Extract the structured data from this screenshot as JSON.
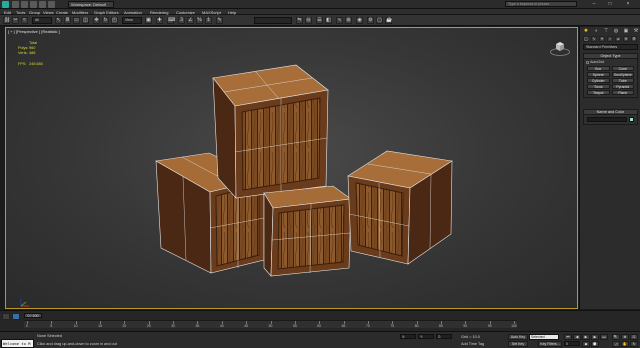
{
  "title_bar": {
    "workspace": "Workspace: Default",
    "search_placeholder": "Type a keyword or phrase",
    "minimize": "–",
    "maximize": "□",
    "close": "×"
  },
  "menu": [
    "Edit",
    "Tools",
    "Group",
    "Views",
    "Create",
    "Modifiers",
    "Graph Editors",
    "Animation",
    "Rendering",
    "Customize",
    "MAXScript",
    "Help"
  ],
  "toolbar": {
    "filter": "All",
    "ref_coord": "View",
    "selection_set": ""
  },
  "viewport": {
    "label": "[ + ] [Perspective ] [Realistic ]",
    "stats": [
      {
        "key": "",
        "value": "Total"
      },
      {
        "key": "Polys:",
        "value": "960"
      },
      {
        "key": "Verts:",
        "value": "488"
      }
    ],
    "fps_label": "FPS:",
    "fps_value": "245.685",
    "wire_color": "#e8e8e8",
    "wood_light": "#8b5a2b",
    "wood_dark": "#4a2812"
  },
  "command_panel": {
    "tabs": [
      "create-tab",
      "modify-tab",
      "hierarchy-tab",
      "motion-tab",
      "display-tab",
      "utilities-tab"
    ],
    "category_icons": [
      "geometry-icon",
      "shapes-icon",
      "lights-icon",
      "cameras-icon",
      "helpers-icon",
      "spacewarps-icon",
      "systems-icon"
    ],
    "dropdown": "Standard Primitives",
    "object_type_header": "Object Type",
    "autogrid": "AutoGrid",
    "buttons": [
      "Box",
      "Cone",
      "Sphere",
      "GeoSphere",
      "Cylinder",
      "Tube",
      "Torus",
      "Pyramid",
      "Teapot",
      "Plane"
    ],
    "name_color_header": "Name and Color",
    "name_value": "",
    "swatch_color": "#9fdcd0"
  },
  "timeline": {
    "slider_label": "0 / 100",
    "ticks": [
      "0",
      "5",
      "10",
      "15",
      "20",
      "25",
      "30",
      "35",
      "40",
      "45",
      "50",
      "55",
      "60",
      "65",
      "70",
      "75",
      "80",
      "85",
      "90",
      "95",
      "100"
    ]
  },
  "status": {
    "maxscript": "Welcome to M",
    "selection_info": "None Selected",
    "prompt": "Click and drag up-and-down to zoom in and out",
    "x": "X:",
    "y": "Y:",
    "z": "Z:",
    "grid": "Grid = 10.0",
    "add_time_tag": "Add Time Tag",
    "auto_key": "Auto Key",
    "selected": "Selected",
    "set_key": "Set Key",
    "key_filters": "Key Filters...",
    "frame": "0"
  }
}
